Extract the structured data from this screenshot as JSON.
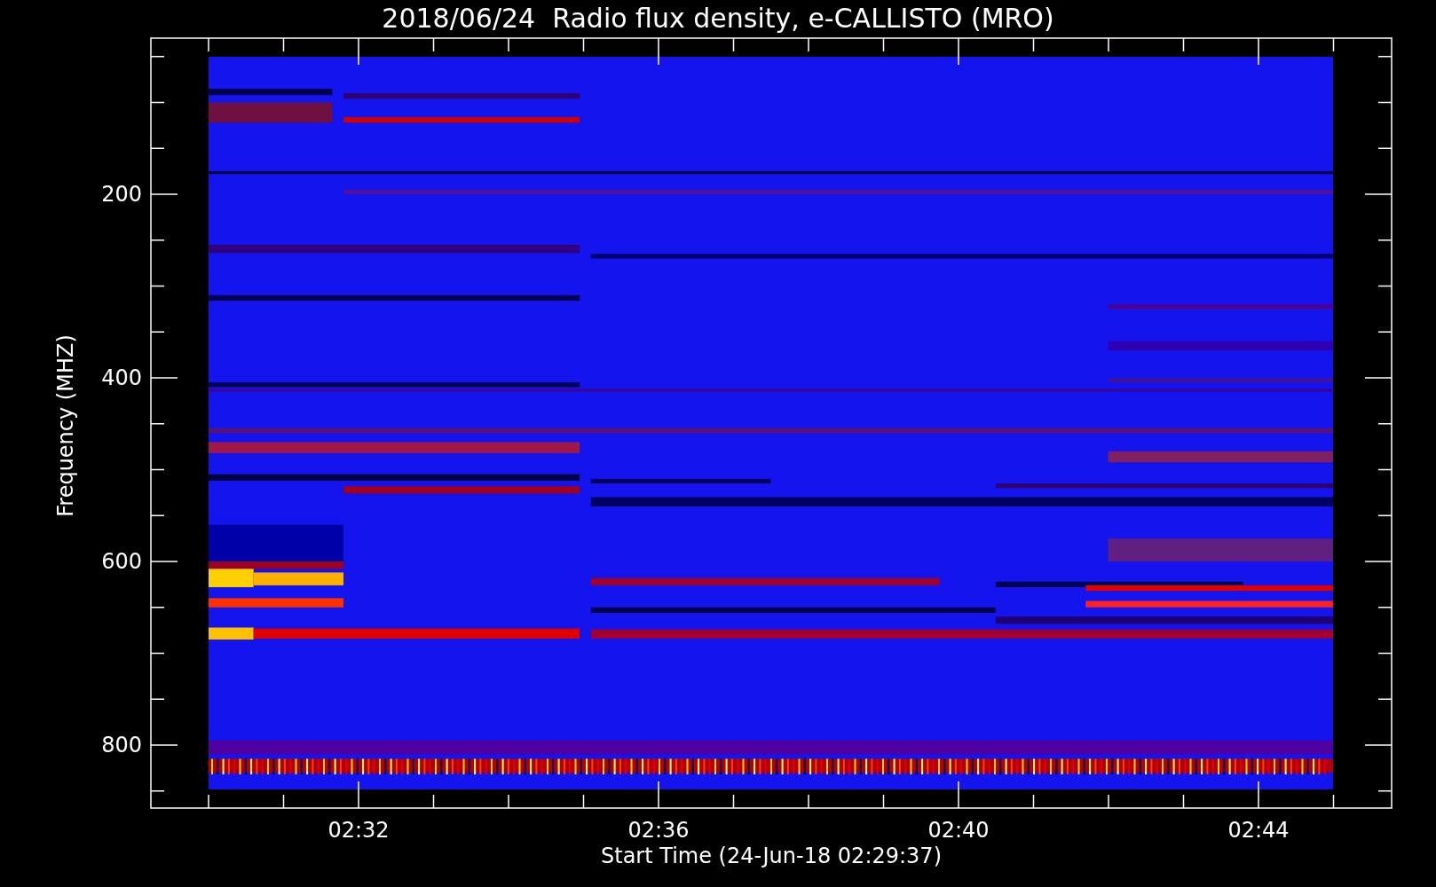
{
  "title": "2018/06/24  Radio flux density, e-CALLISTO (MRO)",
  "y_axis": {
    "label": "Frequency (MHZ)",
    "ticks": [
      "200",
      "400",
      "600",
      "800"
    ]
  },
  "x_axis": {
    "label": "Start Time (24-Jun-18 02:29:37)",
    "ticks": [
      "02:32",
      "02:36",
      "02:40",
      "02:44"
    ]
  }
}
